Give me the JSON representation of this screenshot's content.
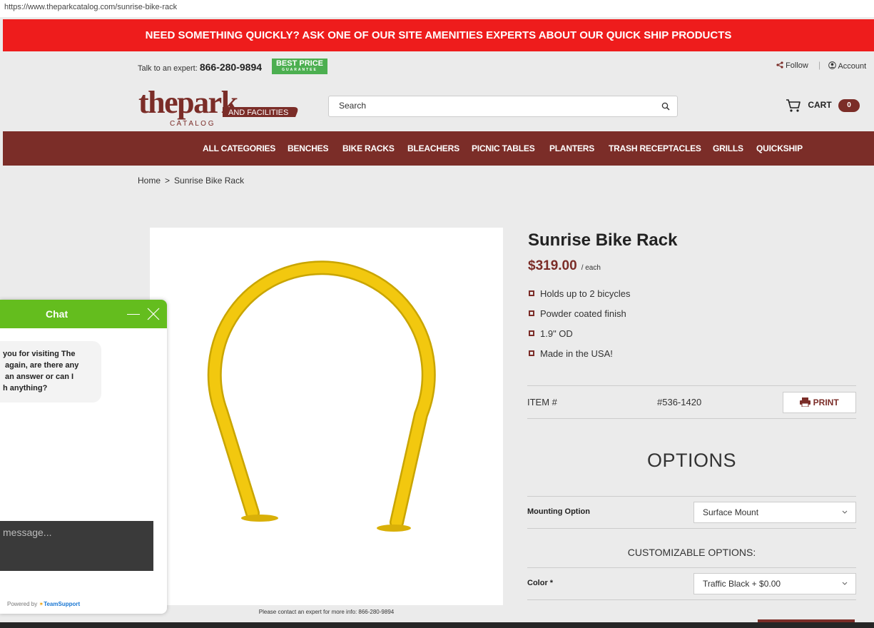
{
  "browser": {
    "url": "https://www.theparkcatalog.com/sunrise-bike-rack"
  },
  "promo": {
    "text": "NEED SOMETHING QUICKLY? ASK ONE OF OUR SITE AMENITIES EXPERTS ABOUT OUR QUICK SHIP PRODUCTS"
  },
  "topbar": {
    "talk_label": "Talk to an expert:",
    "phone": "866-280-9894",
    "badge_top": "BEST PRICE",
    "badge_bottom": "GUARANTEE",
    "follow": "Follow",
    "account": "Account"
  },
  "header": {
    "logo_main": "thepark",
    "logo_sub": "AND FACILITIES",
    "logo_catalog": "C A T A L O G",
    "search_placeholder": "Search",
    "cart_label": "CART",
    "cart_count": "0"
  },
  "nav": {
    "items": [
      "ALL CATEGORIES",
      "BENCHES",
      "BIKE RACKS",
      "BLEACHERS",
      "PICNIC TABLES",
      "PLANTERS",
      "TRASH RECEPTACLES",
      "GRILLS",
      "QUICKSHIP"
    ]
  },
  "breadcrumb": {
    "home": "Home",
    "separator": ">",
    "current": "Sunrise Bike Rack"
  },
  "product": {
    "title": "Sunrise Bike Rack",
    "price": "$319.00",
    "price_unit": "/ each",
    "features": [
      "Holds up to 2 bicycles",
      "Powder coated finish",
      "1.9\" OD",
      "Made in the USA!"
    ],
    "item_label": "ITEM #",
    "item_number": "#536-1420",
    "print_label": "PRINT",
    "image_note": "Please contact an expert for more info: 866-280-9894",
    "rack_color": "#f2c80f"
  },
  "options": {
    "title": "OPTIONS",
    "mounting_label": "Mounting Option",
    "mounting_value": "Surface Mount",
    "custom_title": "CUSTOMIZABLE OPTIONS:",
    "color_label": "Color *",
    "color_value": "Traffic Black + $0.00"
  },
  "chat": {
    "title": "Chat",
    "message": "you for visiting The\n again, are there any\n an answer or can I\nh anything?",
    "input_placeholder": "message...",
    "powered_by": "Powered by",
    "powered_brand": "TeamSupport"
  },
  "colors": {
    "brand": "#7b2d28",
    "promo": "#ee1c1c",
    "chat": "#64bd1e",
    "badge": "#4caf50"
  }
}
